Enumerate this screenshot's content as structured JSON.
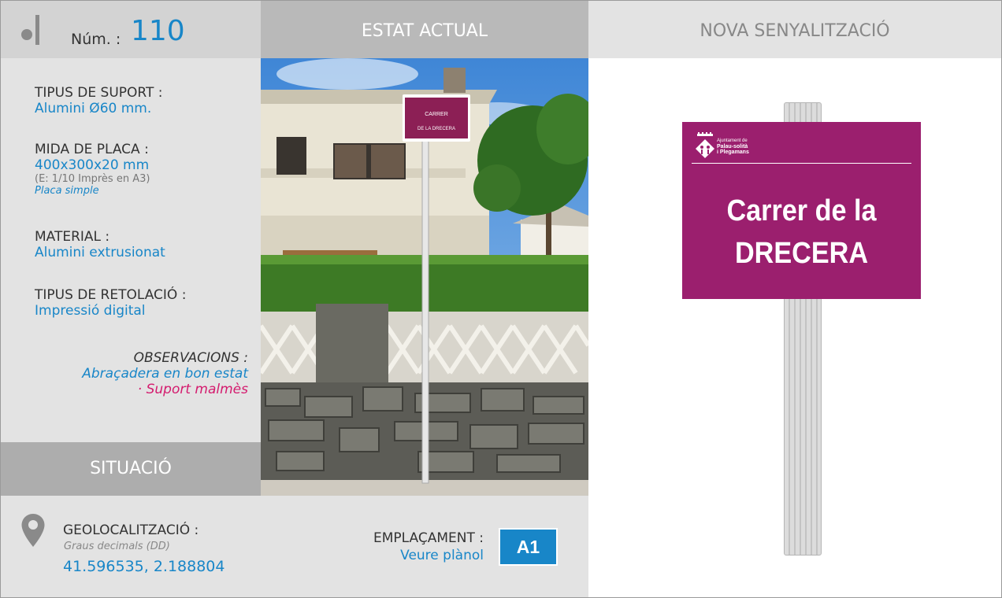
{
  "header": {
    "num_label": "Núm. :",
    "num_value": "110",
    "estat_title": "ESTAT ACTUAL",
    "nova_title": "NOVA SENYALITZACIÓ"
  },
  "fields": {
    "suport_label": "TIPUS DE SUPORT :",
    "suport_value": "Alumini Ø60 mm.",
    "mida_label": "MIDA DE PLACA :",
    "mida_value": "400x300x20 mm",
    "mida_note": "(E: 1/10 Imprès en A3)",
    "mida_sub": "Placa simple",
    "material_label": "MATERIAL :",
    "material_value": "Alumini extrusionat",
    "retolacio_label": "TIPUS DE RETOLACIÓ :",
    "retolacio_value": "Impressió digital"
  },
  "observacions": {
    "label": "OBSERVACIONS :",
    "good": "Abraçadera en bon estat",
    "bad": "· Suport malmès"
  },
  "situacio": {
    "title": "SITUACIÓ",
    "geo_label": "GEOLOCALITZACIÓ :",
    "geo_note": "Graus decimals (DD)",
    "geo_coords": "41.596535, 2.188804",
    "emp_label": "EMPLAÇAMENT :",
    "emp_link": "Veure plànol",
    "emp_code": "A1"
  },
  "photo": {
    "sign_line1": "CARRER",
    "sign_line2": "DE LA DRECERA"
  },
  "new_sign": {
    "org_line1": "Ajuntament de",
    "org_line2": "Palau-solità",
    "org_line3": "i Plegamans",
    "street_line1": "Carrer de la",
    "street_line2": "DRECERA"
  },
  "colors": {
    "accent_blue": "#1886c8",
    "alert_pink": "#d41b6e",
    "sign_purple": "#9b1f6e"
  }
}
